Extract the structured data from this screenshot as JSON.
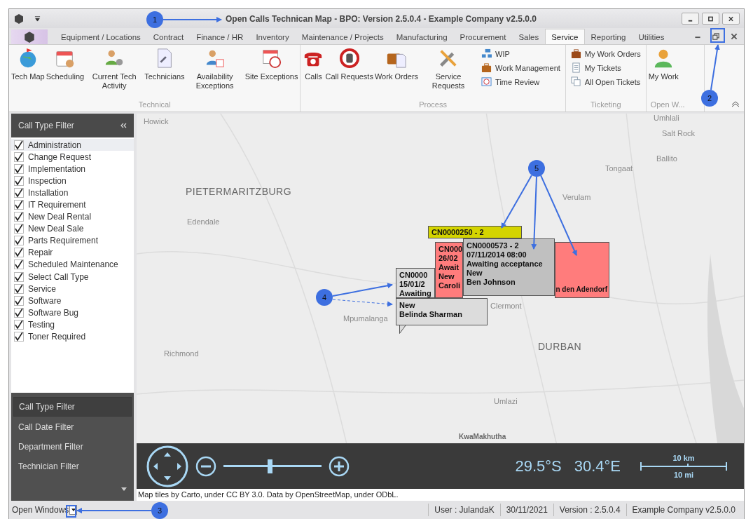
{
  "title_bar": {
    "title": "Open Calls Technican Map - BPO: Version 2.5.0.4 - Example Company v2.5.0.0"
  },
  "tabs": [
    {
      "label": "Equipment / Locations",
      "selected": false
    },
    {
      "label": "Contract",
      "selected": false
    },
    {
      "label": "Finance / HR",
      "selected": false
    },
    {
      "label": "Inventory",
      "selected": false
    },
    {
      "label": "Maintenance / Projects",
      "selected": false
    },
    {
      "label": "Manufacturing",
      "selected": false
    },
    {
      "label": "Procurement",
      "selected": false
    },
    {
      "label": "Sales",
      "selected": false
    },
    {
      "label": "Service",
      "selected": true
    },
    {
      "label": "Reporting",
      "selected": false
    },
    {
      "label": "Utilities",
      "selected": false
    }
  ],
  "ribbon": {
    "groups": [
      {
        "label": "Technical",
        "buttons": [
          "Tech Map",
          "Scheduling",
          "Current Tech Activity",
          "Technicians",
          "Availability Exceptions",
          "Site Exceptions"
        ]
      },
      {
        "label": "Process",
        "buttons": [
          "Calls",
          "Call Requests",
          "Work Orders",
          "Service Requests"
        ],
        "small_buttons": [
          "WIP",
          "Work Management",
          "Time Review"
        ]
      },
      {
        "label": "Ticketing",
        "small_buttons": [
          "My Work Orders",
          "My Tickets",
          "All Open Tickets"
        ]
      },
      {
        "label": "Open W...",
        "buttons": [
          "My Work"
        ]
      }
    ]
  },
  "filter_panel": {
    "header": "Call Type Filter",
    "items": [
      {
        "label": "Administration",
        "checked": true,
        "selected": true
      },
      {
        "label": "Change Request",
        "checked": true,
        "selected": false
      },
      {
        "label": "Implementation",
        "checked": true,
        "selected": false
      },
      {
        "label": "Inspection",
        "checked": true,
        "selected": false
      },
      {
        "label": "Installation",
        "checked": true,
        "selected": false
      },
      {
        "label": "IT Requirement",
        "checked": true,
        "selected": false
      },
      {
        "label": "New Deal Rental",
        "checked": true,
        "selected": false
      },
      {
        "label": "New Deal Sale",
        "checked": true,
        "selected": false
      },
      {
        "label": "Parts Requirement",
        "checked": true,
        "selected": false
      },
      {
        "label": "Repair",
        "checked": true,
        "selected": false
      },
      {
        "label": "Scheduled Maintenance",
        "checked": true,
        "selected": false
      },
      {
        "label": "Select Call Type",
        "checked": true,
        "selected": false
      },
      {
        "label": "Service",
        "checked": true,
        "selected": false
      },
      {
        "label": "Software",
        "checked": true,
        "selected": false
      },
      {
        "label": "Software Bug",
        "checked": true,
        "selected": false
      },
      {
        "label": "Testing",
        "checked": true,
        "selected": false
      },
      {
        "label": "Toner Required",
        "checked": true,
        "selected": false
      }
    ],
    "nav": [
      {
        "label": "Call Type Filter",
        "selected": true
      },
      {
        "label": "Call Date Filter",
        "selected": false
      },
      {
        "label": "Department Filter",
        "selected": false
      },
      {
        "label": "Technician Filter",
        "selected": false
      }
    ]
  },
  "map": {
    "places": [
      {
        "name": "Umhlali",
        "kind": "town"
      },
      {
        "name": "Howick",
        "kind": "town"
      },
      {
        "name": "Salt Rock",
        "kind": "town"
      },
      {
        "name": "Ballito",
        "kind": "town"
      },
      {
        "name": "Tongaat",
        "kind": "town"
      },
      {
        "name": "PIETERMARITZBURG",
        "kind": "city"
      },
      {
        "name": "Verulam",
        "kind": "town"
      },
      {
        "name": "Edendale",
        "kind": "town"
      },
      {
        "name": "Clermont",
        "kind": "town"
      },
      {
        "name": "Mpumalanga",
        "kind": "town"
      },
      {
        "name": "DURBAN",
        "kind": "city"
      },
      {
        "name": "Richmond",
        "kind": "town"
      },
      {
        "name": "Umlazi",
        "kind": "town"
      },
      {
        "name": "KwaMakhutha",
        "kind": "dim"
      }
    ],
    "callouts": [
      {
        "color": "#d4d400",
        "lines": [
          "CN0000250 - 2"
        ]
      },
      {
        "color": "#dcdcdc",
        "lines": [
          "CN0000",
          "15/01/2",
          "Awaiting"
        ],
        "more_lines": [
          "New",
          "Belinda Sharman"
        ]
      },
      {
        "color": "#ff7c7c",
        "lines": [
          "CN000",
          "26/02",
          "Await",
          "New",
          "Caroli"
        ],
        "more_lines": [
          "n den Adendorf"
        ]
      },
      {
        "color": "#c0c0c0",
        "lines": [
          "CN0000573 - 2",
          "07/11/2014 08:00",
          "Awaiting acceptance",
          "New",
          "Ben Johnson"
        ]
      }
    ],
    "zoom": {
      "level": 0.47
    },
    "latitude": "29.5°S",
    "longitude": "30.4°E",
    "scale_km": "10 km",
    "scale_mi": "10 mi",
    "attribution": "Map tiles by Carto, under CC BY 3.0. Data by OpenStreetMap, under ODbL."
  },
  "status_bar": {
    "open_windows": "Open Windows",
    "fields": [
      "User : JulandaK",
      "30/11/2021",
      "Version : 2.5.0.4",
      "Example Company v2.5.0.0"
    ]
  },
  "annotations": [
    "1",
    "2",
    "3",
    "4",
    "5"
  ]
}
